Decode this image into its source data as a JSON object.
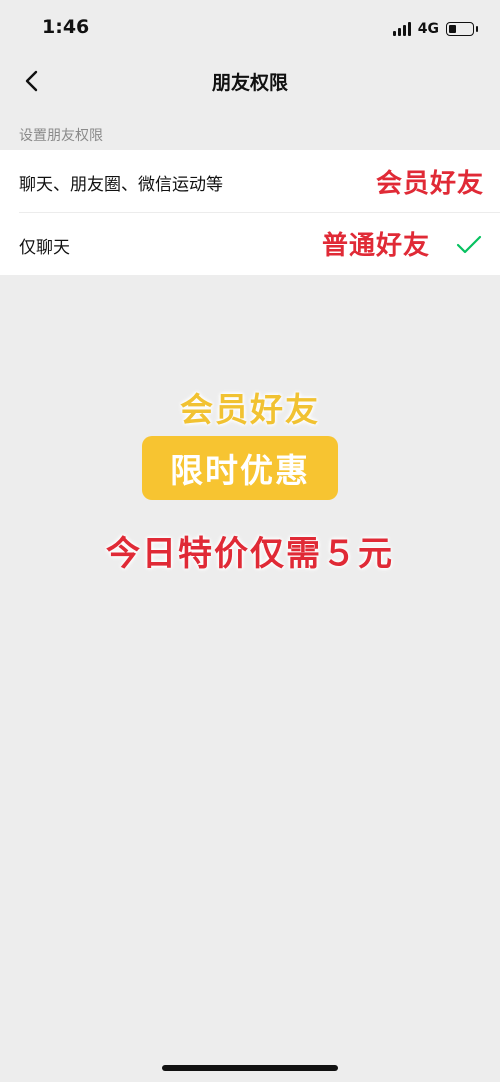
{
  "status_bar": {
    "time": "1:46",
    "network": "4G",
    "battery_level": 0.3
  },
  "nav": {
    "title": "朋友权限"
  },
  "section": {
    "label": "设置朋友权限"
  },
  "options": [
    {
      "label": "聊天、朋友圈、微信运动等",
      "tag": "会员好友",
      "selected": false
    },
    {
      "label": "仅聊天",
      "tag": "普通好友",
      "selected": true
    }
  ],
  "promo": {
    "title": "会员好友",
    "badge": "限时优惠",
    "price_text": "今日特价仅需５元"
  },
  "colors": {
    "background": "#ededed",
    "accent_red": "#e02a36",
    "accent_yellow": "#f7c431",
    "check_green": "#07c160"
  },
  "icons": {
    "back": "chevron-left-icon",
    "check": "checkmark-icon"
  }
}
